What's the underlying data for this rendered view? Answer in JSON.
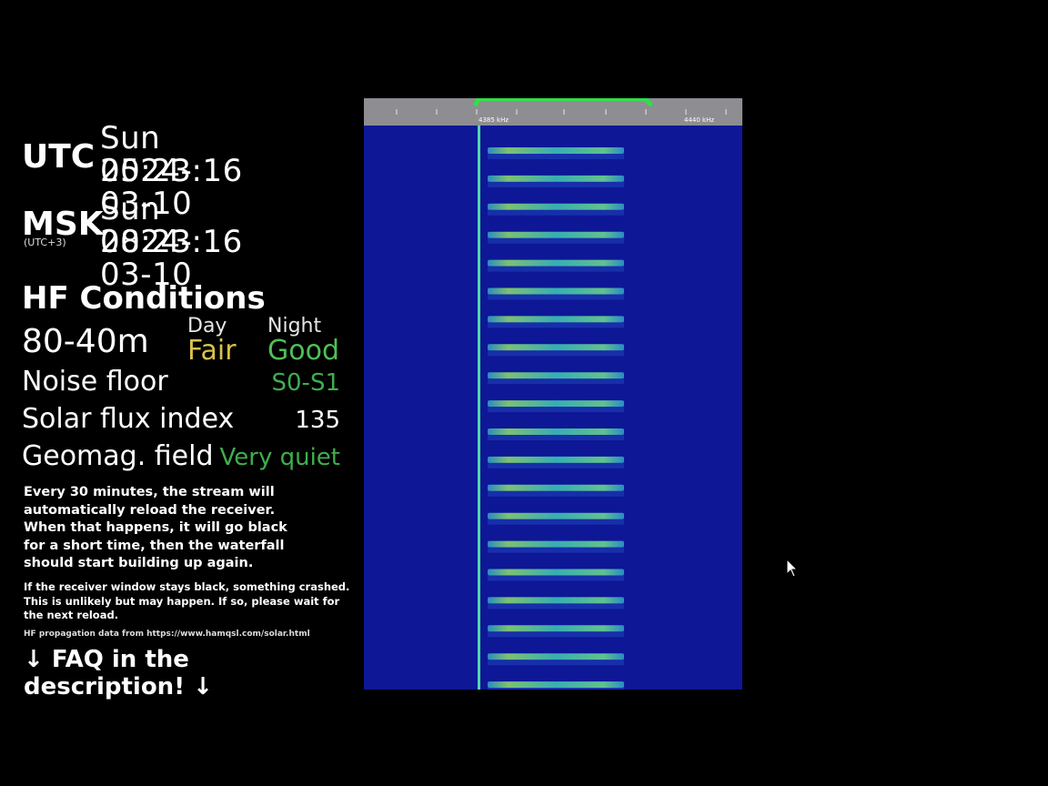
{
  "clocks": [
    {
      "label": "UTC",
      "sublabel": "",
      "date": "Sun 2024-03-10",
      "time": "05:23:16"
    },
    {
      "label": "MSK",
      "sublabel": "(UTC+3)",
      "date": "Sun 2024-03-10",
      "time": "08:23:16"
    }
  ],
  "hf": {
    "title": "HF Conditions",
    "band": "80-40m",
    "day_header": "Day",
    "night_header": "Night",
    "day_value": "Fair",
    "night_value": "Good",
    "noise_label": "Noise floor",
    "noise_value": "S0-S1",
    "sfi_label": "Solar flux index",
    "sfi_value": "135",
    "geomag_label": "Geomag. field",
    "geomag_value": "Very quiet"
  },
  "notes": {
    "reload_lines": [
      "Every 30 minutes, the stream will",
      "automatically reload the receiver.",
      "When that happens, it will go black",
      "for a short time, then the waterfall",
      "should start building up again."
    ],
    "crash_lines": [
      "If the receiver window stays black, something crashed.",
      "This is unlikely but may happen. If so, please wait for",
      "the next reload."
    ],
    "source": "HF propagation data from https://www.hamqsl.com/solar.html",
    "faq": "↓ FAQ in the description! ↓"
  },
  "waterfall": {
    "scale_left": "4385 kHz",
    "scale_right": "4440 kHz",
    "signal_rows": 20
  },
  "colors": {
    "fair": "#d8c24a",
    "good": "#4fbf56",
    "status_green": "#3fae4f",
    "waterfall_bg": "#0e1796",
    "passband": "#2fe04a"
  }
}
